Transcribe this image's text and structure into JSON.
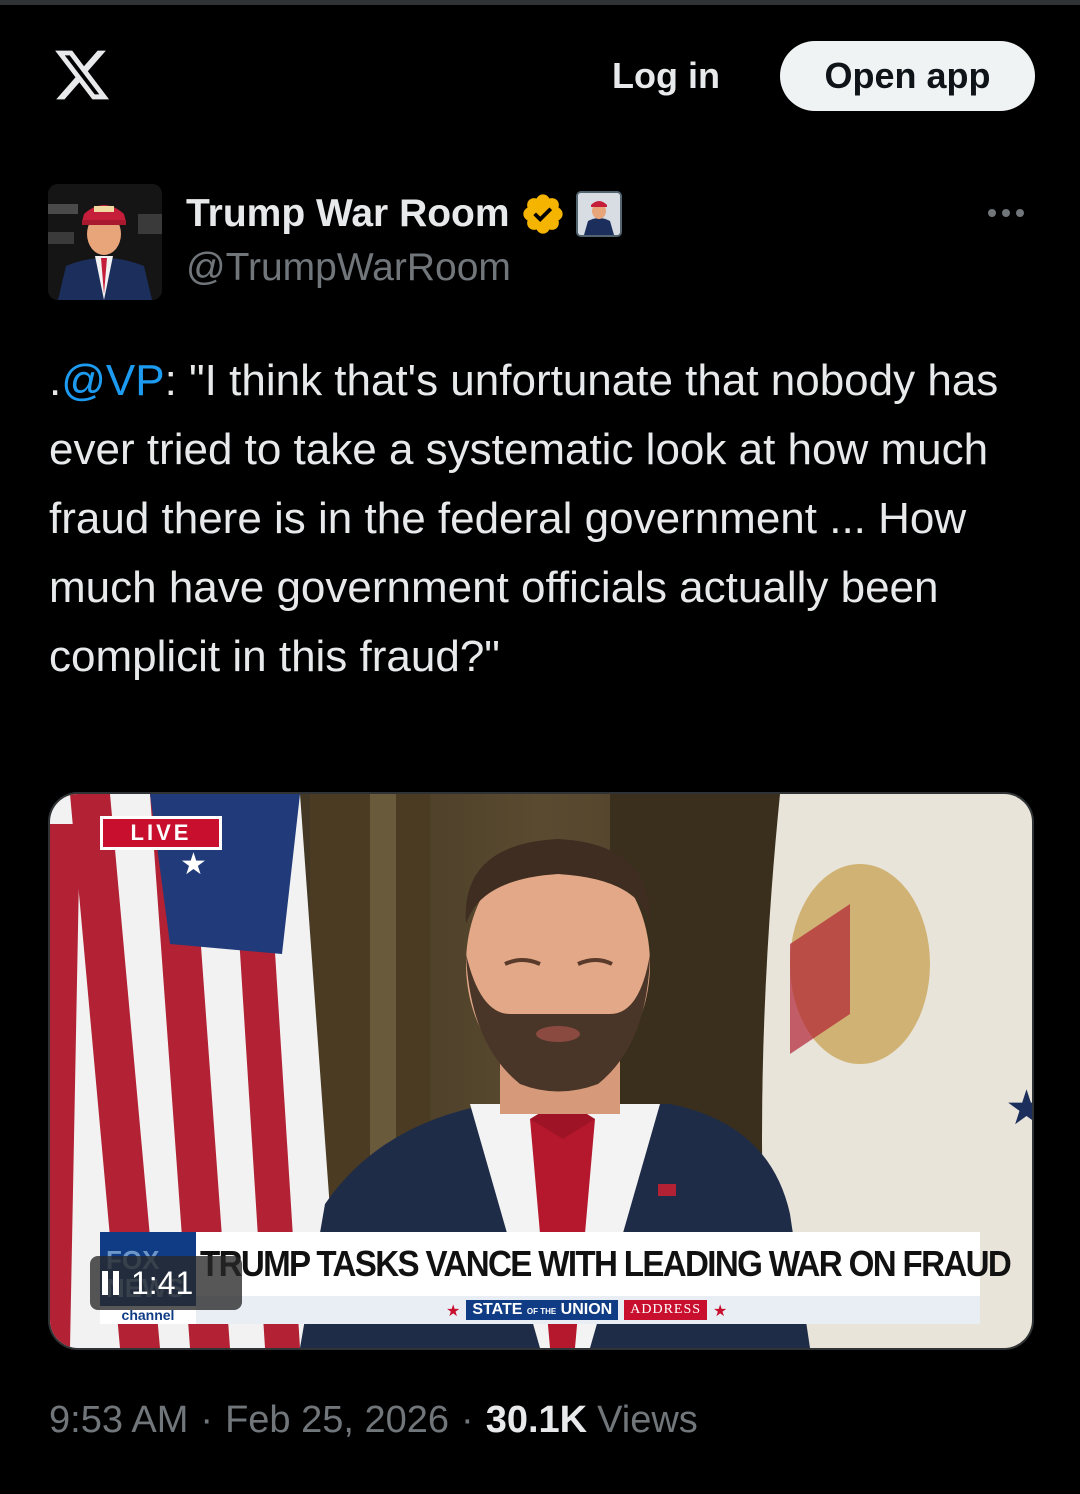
{
  "header": {
    "logo_icon": "x-logo-icon",
    "login_label": "Log in",
    "open_app_label": "Open app"
  },
  "author": {
    "display_name": "Trump War Room",
    "handle": "@TrumpWarRoom",
    "verified_icon": "verified-badge-icon",
    "verified_color": "#f4b400",
    "affiliate_icon": "affiliate-badge-icon"
  },
  "tweet": {
    "prefix": ".",
    "mention": "@VP",
    "text": ": \"I think that's unfortunate that nobody has ever tried to take a systematic look at how much fraud there is in the federal government ... How much have government officials actually been complicit in this fraud?\"",
    "mention_color": "#1d9bf0"
  },
  "video": {
    "live_badge": "LIVE",
    "network_logo": "FOX NEWS",
    "network_channel": "channel",
    "headline": "TRUMP TASKS VANCE WITH LEADING WAR ON FRAUD",
    "banner_state": "STATE",
    "banner_of_the": "OF THE",
    "banner_union": "UNION",
    "banner_address": "ADDRESS",
    "duration": "1:41",
    "play_state": "paused-icon"
  },
  "meta": {
    "time": "9:53 AM",
    "separator": "·",
    "date": "Feb 25, 2026",
    "views_count": "30.1K",
    "views_label": "Views"
  }
}
